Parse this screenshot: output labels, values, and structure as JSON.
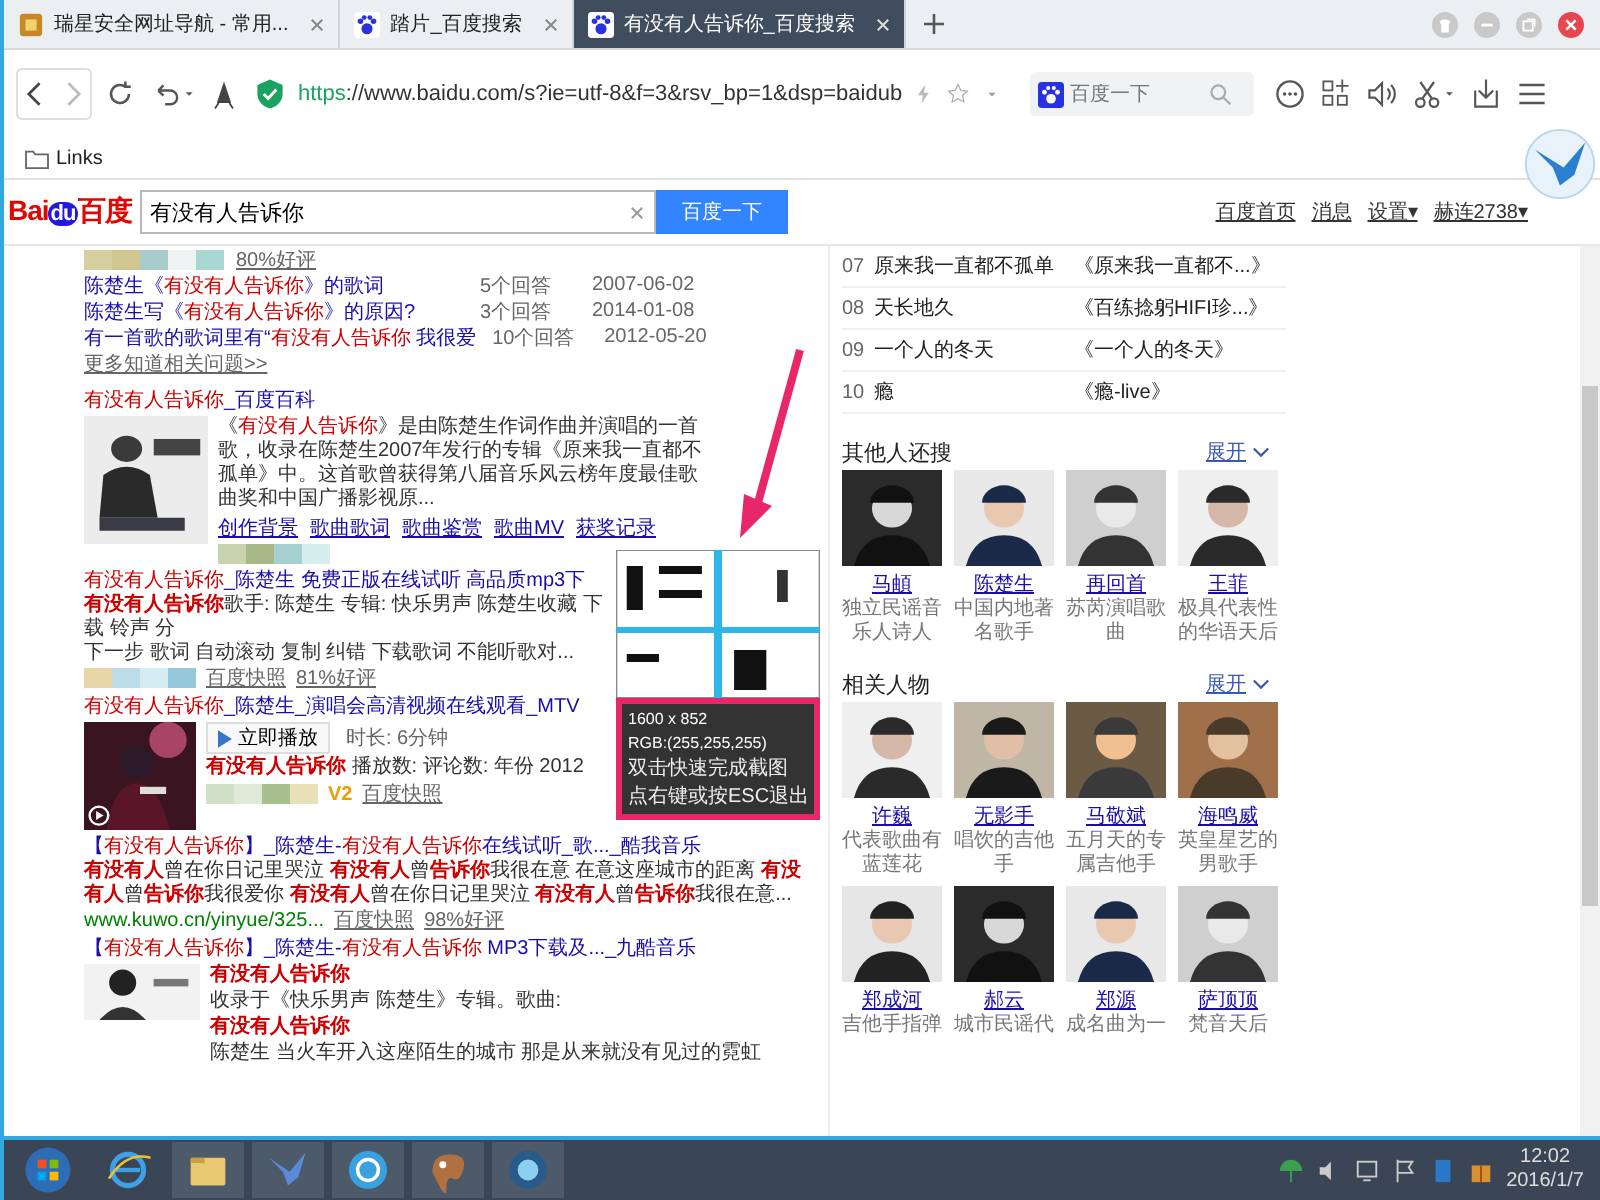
{
  "tabs": [
    {
      "title": "瑞星安全网址导航 - 常用...",
      "kind": "home",
      "selected": false
    },
    {
      "title": "踏片_百度搜索",
      "kind": "paw",
      "selected": false
    },
    {
      "title": "有没有人告诉你_百度搜索",
      "kind": "paw",
      "selected": true
    }
  ],
  "address": {
    "scheme": "https",
    "rest": "://www.baidu.com/s?ie=utf-8&f=3&rsv_bp=1&dsp=baidub"
  },
  "toolbar_search": {
    "placeholder": "百度一下"
  },
  "bookmarks": [
    "Links"
  ],
  "baidu": {
    "logo": [
      "Bai",
      "du",
      "百度"
    ],
    "query": "有没有人告诉你",
    "button": "百度一下",
    "links": [
      "百度首页",
      "消息",
      "设置▾",
      "赫连2738▾"
    ]
  },
  "zhidao": {
    "rating": "80%好评",
    "questions": [
      {
        "title": [
          {
            "t": "陈楚生《",
            "hl": false
          },
          {
            "t": "有没有人告诉你",
            "hl": true
          },
          {
            "t": "》的歌词",
            "hl": false
          }
        ],
        "answers": "5个回答",
        "date": "2007-06-02"
      },
      {
        "title": [
          {
            "t": "陈楚生写《",
            "hl": false
          },
          {
            "t": "有没有人告诉你",
            "hl": true
          },
          {
            "t": "》的原因?",
            "hl": false
          }
        ],
        "answers": "3个回答",
        "date": "2014-01-08"
      },
      {
        "title": [
          {
            "t": "有一首歌的歌词里有“",
            "hl": false
          },
          {
            "t": "有没有人告诉你",
            "hl": true
          },
          {
            "t": " 我很爱",
            "hl": false
          }
        ],
        "answers": "10个回答",
        "date": "2012-05-20"
      }
    ],
    "more": "更多知道相关问题>>"
  },
  "baike": {
    "title": [
      {
        "t": "有没有人告诉你",
        "hl": true
      },
      {
        "t": "_百度百科",
        "hl": false
      }
    ],
    "snippet": [
      {
        "t": "《",
        "hl": false
      },
      {
        "t": "有没有人告诉你",
        "hl": true
      },
      {
        "t": "》是由陈楚生作词作曲并演唱的一首歌，收录在陈楚生2007年发行的专辑《原来我一直都不孤单》中。这首歌曾获得第八届音乐风云榜年度最佳歌曲奖和中国广播影视原...",
        "hl": false
      }
    ],
    "links": [
      "创作背景",
      "歌曲歌词",
      "歌曲鉴赏",
      "歌曲MV",
      "获奖记录"
    ]
  },
  "music": {
    "title": [
      {
        "t": "有没有人告诉你",
        "hl": true
      },
      {
        "t": "_陈楚生 免费正版在线试听 高品质mp3下",
        "hl": false
      }
    ],
    "snippet": [
      {
        "t": "有没有人告诉你",
        "hl": true
      },
      {
        "t": "歌手: 陈楚生 专辑: 快乐男声 陈楚生收藏 下载 铃声 分",
        "hl": false
      }
    ],
    "snippet2": "下一步 歌词 自动滚动 复制 纠错 下载歌词 不能听歌对...",
    "snapshot": "百度快照",
    "rating": "81%好评"
  },
  "video": {
    "title": [
      {
        "t": "有没有人告诉你",
        "hl": true
      },
      {
        "t": "_陈楚生_演唱会高清视频在线观看_MTV",
        "hl": false
      }
    ],
    "play": "立即播放",
    "duration": "时长: 6分钟",
    "info": [
      {
        "t": "有没有人告诉你",
        "hl": true
      },
      {
        "t": " 播放数: 评论数: 年份 2012",
        "hl": false
      }
    ],
    "badge": "V2",
    "snapshot": "百度快照"
  },
  "kuwo": {
    "title": [
      {
        "t": "【",
        "hl": false
      },
      {
        "t": "有没有人告诉你",
        "hl": true
      },
      {
        "t": "】_陈楚生-",
        "hl": false
      },
      {
        "t": "有没有人告诉你",
        "hl": true
      },
      {
        "t": "在线试听_歌..._酷我音乐",
        "hl": false
      }
    ],
    "snippet": [
      {
        "t": "有没有人",
        "hl": true
      },
      {
        "t": "曾在你日记里哭泣 ",
        "hl": false
      },
      {
        "t": "有没有人",
        "hl": true
      },
      {
        "t": "曾",
        "hl": false
      },
      {
        "t": "告诉你",
        "hl": true
      },
      {
        "t": "我很在意 在意这座城市的距离 ",
        "hl": false
      },
      {
        "t": "有没有人",
        "hl": true
      },
      {
        "t": "曾",
        "hl": false
      },
      {
        "t": "告诉你",
        "hl": true
      },
      {
        "t": "我很爱你 ",
        "hl": false
      },
      {
        "t": "有没有人",
        "hl": true
      },
      {
        "t": "曾在你日记里哭泣 ",
        "hl": false
      },
      {
        "t": "有没有人",
        "hl": true
      },
      {
        "t": "曾",
        "hl": false
      },
      {
        "t": "告诉你",
        "hl": true
      },
      {
        "t": "我很在意...",
        "hl": false
      }
    ],
    "url": "www.kuwo.cn/yinyue/325...",
    "snapshot": "百度快照",
    "rating": "98%好评"
  },
  "jiuku": {
    "title": [
      {
        "t": "【",
        "hl": false
      },
      {
        "t": "有没有人告诉你",
        "hl": true
      },
      {
        "t": "】_陈楚生-",
        "hl": false
      },
      {
        "t": "有没有人告诉你",
        "hl": true
      },
      {
        "t": " MP3下载及..._九酷音乐",
        "hl": false
      }
    ],
    "snippet": [
      {
        "t": "有没有人告诉你",
        "hl": true
      },
      {
        "t": "收录于《快乐男声 陈楚生》专辑。歌曲:",
        "hl": false
      },
      {
        "t": "有没有人告诉你",
        "hl": true
      },
      {
        "t": " 陈楚生 当火车开入这座陌生的城市 那是从来就没有见过的霓虹",
        "hl": false
      }
    ]
  },
  "songs": [
    {
      "num": "07",
      "title": "原来我一直都不孤单",
      "album": "《原来我一直都不...》"
    },
    {
      "num": "08",
      "title": "天长地久",
      "album": "《百练捻躬HIFI珍...》"
    },
    {
      "num": "09",
      "title": "一个人的冬天",
      "album": "《一个人的冬天》"
    },
    {
      "num": "10",
      "title": "瘾",
      "album": "《瘾-live》"
    }
  ],
  "also_searched": {
    "heading": "其他人还搜",
    "expand": "展开",
    "people": [
      {
        "name": "马頔",
        "desc": "独立民谣音乐人诗人"
      },
      {
        "name": "陈楚生",
        "desc": "中国内地著名歌手"
      },
      {
        "name": "再回首",
        "desc": "苏芮演唱歌曲"
      },
      {
        "name": "王菲",
        "desc": "极具代表性的华语天后"
      }
    ]
  },
  "related": {
    "heading": "相关人物",
    "expand": "展开",
    "people": [
      {
        "name": "许巍",
        "desc": "代表歌曲有蓝莲花"
      },
      {
        "name": "无影手",
        "desc": "唱饮的吉他手"
      },
      {
        "name": "马敬斌",
        "desc": "五月天的专属吉他手"
      },
      {
        "name": "海鸣威",
        "desc": "英皇星艺的男歌手"
      },
      {
        "name": "郑成河",
        "desc": "吉他手指弹"
      },
      {
        "name": "郝云",
        "desc": "城市民谣代"
      },
      {
        "name": "郑源",
        "desc": "成名曲为一"
      },
      {
        "name": "萨顶顶",
        "desc": "梵音天后"
      }
    ]
  },
  "capture": {
    "size": "1600 x 852",
    "rgb": "RGB:(255,255,255)",
    "hint1": "双击快速完成截图",
    "hint2": "点右键或按ESC退出"
  },
  "clock": {
    "time": "12:02",
    "date": "2016/1/7"
  }
}
